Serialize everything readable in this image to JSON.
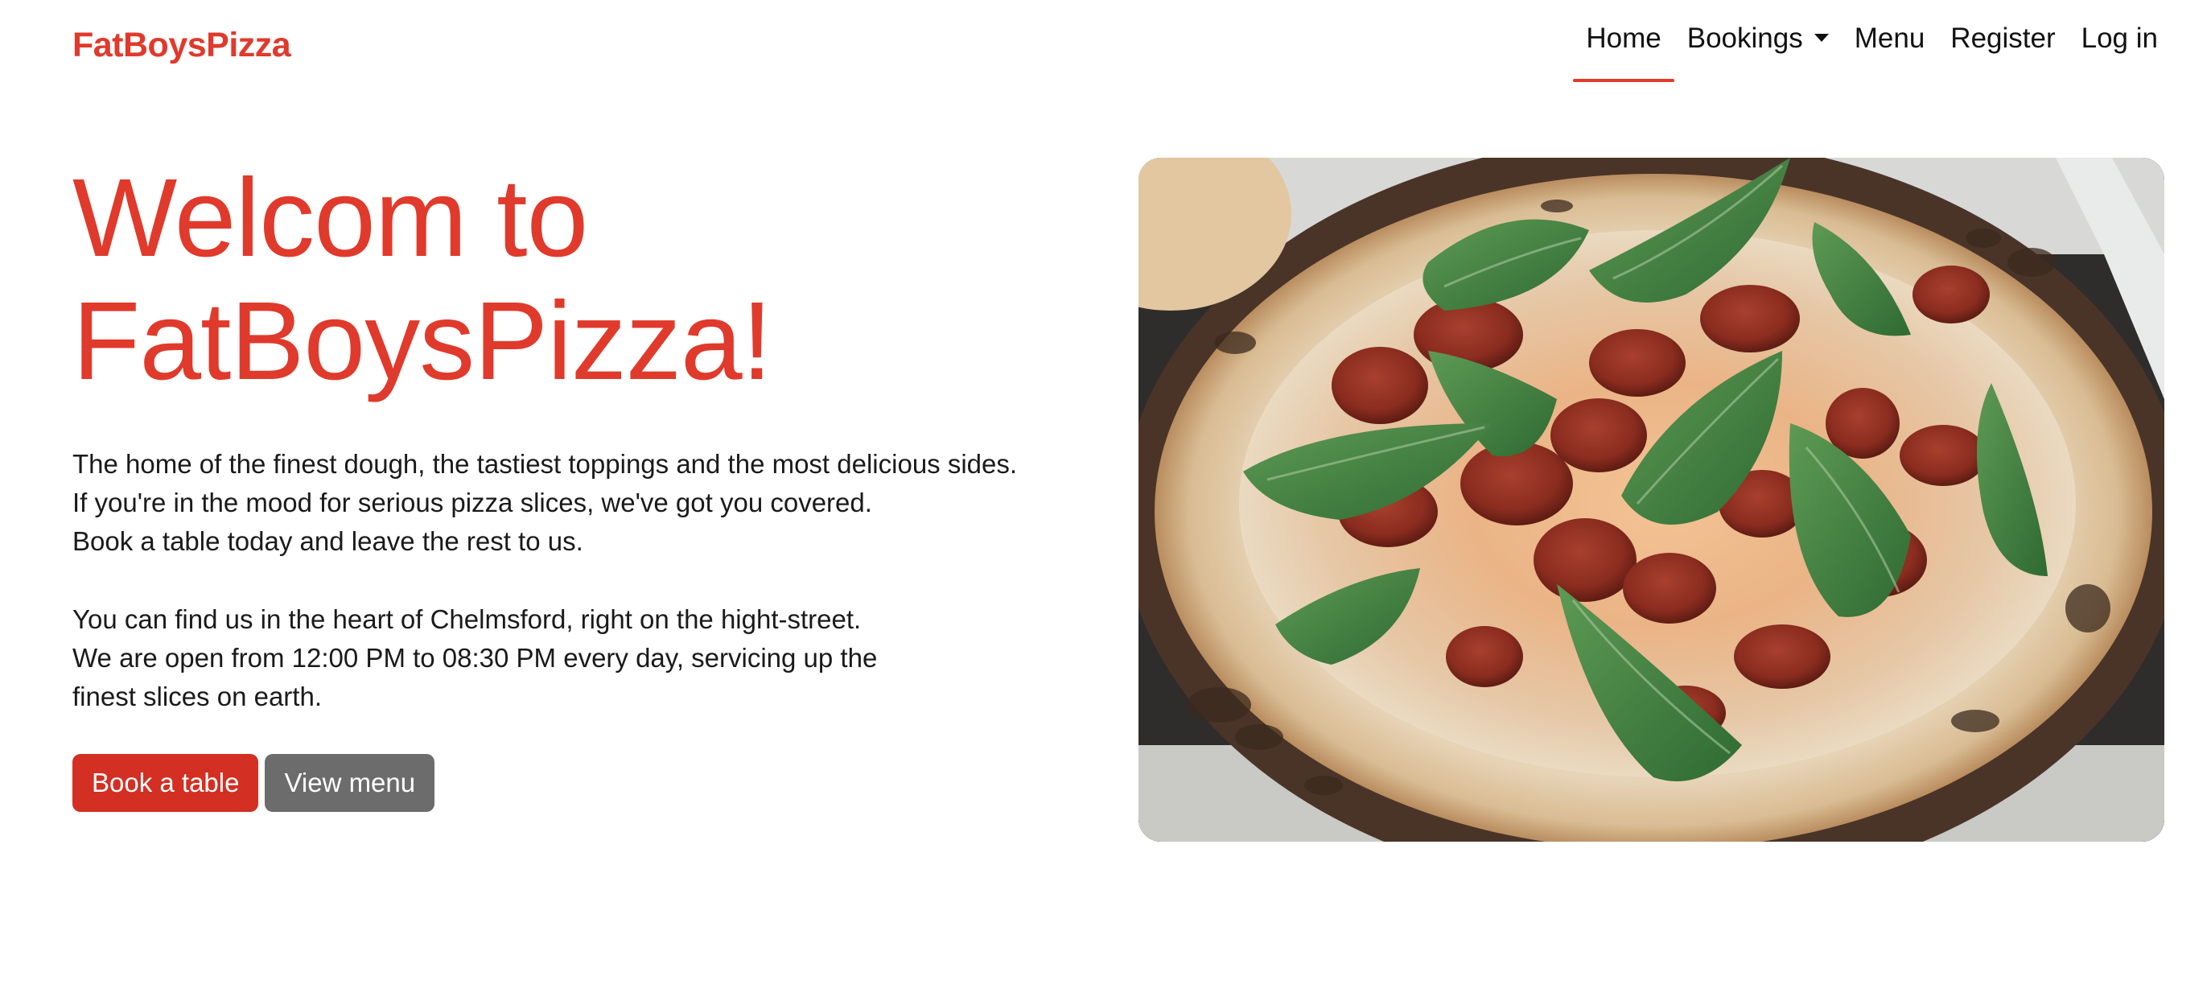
{
  "navbar": {
    "brand": "FatBoysPizza",
    "items": [
      {
        "label": "Home",
        "active": true
      },
      {
        "label": "Bookings",
        "dropdown": true
      },
      {
        "label": "Menu"
      },
      {
        "label": "Register"
      },
      {
        "label": "Log in"
      }
    ]
  },
  "hero": {
    "title_lines": [
      "Welcom to",
      "FatBoysPizza!"
    ],
    "paragraph1": [
      "The home of the finest dough, the tastiest toppings and the most delicious sides.",
      "If you're in the mood for serious pizza slices, we've got you covered.",
      "Book a table today and leave the rest to us."
    ],
    "paragraph2": [
      "You can find us in the heart of Chelmsford, right on the hight-street.",
      "We are open from 12:00 PM to 08:30 PM every day, servicing up the",
      "finest slices on earth."
    ],
    "buttons": {
      "book": "Book a table",
      "menu": "View menu"
    }
  },
  "colors": {
    "brand_red": "#e03a2c",
    "button_primary": "#d32f22",
    "button_secondary": "#6c6c6c"
  }
}
